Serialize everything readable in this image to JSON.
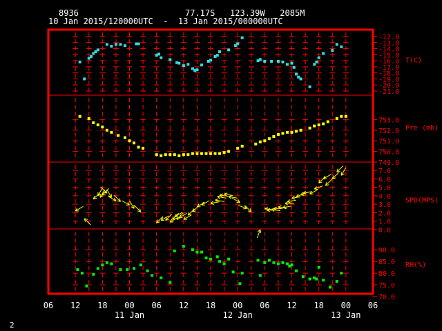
{
  "header": {
    "station_id": "8936",
    "location": "77.17S   123.39W   2085M",
    "time_range": "10 Jan 2015/120000UTC  -  13 Jan 2015/000000UTC"
  },
  "footer": {
    "page_number": "2"
  },
  "colors": {
    "background": "#000000",
    "frame": "#ff0000",
    "header_text": "#ffffff",
    "temperature": "#33dddd",
    "pressure": "#ffff00",
    "wind": "#ffff00",
    "humidity": "#00ee00"
  },
  "chart_data": {
    "type": "scatter",
    "x_unit": "hours since 10 Jan 2015 06 UTC",
    "xlim": [
      0,
      72
    ],
    "x_ticks": [
      {
        "x": 0,
        "label": "06"
      },
      {
        "x": 6,
        "label": "12"
      },
      {
        "x": 12,
        "label": "18"
      },
      {
        "x": 18,
        "label": "00"
      },
      {
        "x": 24,
        "label": "06"
      },
      {
        "x": 30,
        "label": "12"
      },
      {
        "x": 36,
        "label": "18"
      },
      {
        "x": 42,
        "label": "00"
      },
      {
        "x": 48,
        "label": "06"
      },
      {
        "x": 54,
        "label": "12"
      },
      {
        "x": 60,
        "label": "18"
      },
      {
        "x": 66,
        "label": "00"
      },
      {
        "x": 72,
        "label": "06"
      }
    ],
    "day_labels": [
      {
        "x": 18,
        "label": "11 Jan"
      },
      {
        "x": 42,
        "label": "12 Jan"
      },
      {
        "x": 66,
        "label": "13 Jan"
      }
    ],
    "grid_hours": [
      6,
      9,
      12,
      15,
      18,
      21,
      24,
      27,
      30,
      33,
      36,
      39,
      42,
      45,
      48,
      51,
      54,
      57,
      60,
      63,
      66
    ],
    "panels": [
      {
        "id": "temperature",
        "label": "T(C)",
        "ylim": [
          -21,
          -12
        ],
        "ticks": [
          -12,
          -13,
          -14,
          -15,
          -16,
          -17,
          -18,
          -19,
          -20,
          -21
        ],
        "tick_labels": [
          "-12.0",
          "-13.0",
          "-14.0",
          "-15.0",
          "-16.0",
          "-17.0",
          "-18.0",
          "-19.0",
          "-20.0",
          "-21.0"
        ],
        "x": [
          7,
          8,
          9,
          9.5,
          10,
          10.5,
          11,
          13,
          14,
          15,
          16,
          17,
          19.5,
          20,
          24,
          24.5,
          25,
          27,
          28.5,
          29,
          30,
          31,
          32,
          32.5,
          33,
          34,
          35.5,
          36,
          37,
          37.5,
          38,
          40,
          41.5,
          42,
          43,
          46.5,
          47,
          48,
          49.5,
          51,
          52,
          53,
          54,
          54.5,
          55,
          55.5,
          56,
          58,
          59,
          59.5,
          60,
          61,
          63,
          64,
          65
        ],
        "y": [
          -16.2,
          -19,
          -15.6,
          -15.3,
          -14.8,
          -14.5,
          -14.2,
          -13.3,
          -13.6,
          -13.3,
          -13.3,
          -13.5,
          -13.2,
          -13.2,
          -15.1,
          -14.9,
          -15.5,
          -15.8,
          -16.3,
          -16.4,
          -16.8,
          -16.6,
          -17.3,
          -17.6,
          -17.5,
          -16.7,
          -16.1,
          -15.9,
          -15.3,
          -15.1,
          -14.5,
          -14.2,
          -13.5,
          -13.2,
          -12.2,
          -16,
          -15.8,
          -16.1,
          -16.1,
          -16.1,
          -16.2,
          -16.6,
          -16.4,
          -17.1,
          -18.2,
          -18.7,
          -19,
          -20.3,
          -16.6,
          -16.2,
          -15.5,
          -14.8,
          -14.3,
          -13.3,
          -13.7
        ]
      },
      {
        "id": "pressure",
        "label": "Pre (mb)",
        "ylim": [
          749,
          754
        ],
        "ticks": [
          749,
          750,
          751,
          752,
          753
        ],
        "tick_labels": [
          "749.0",
          "750.0",
          "751.0",
          "752.0",
          "753.0"
        ],
        "x": [
          7,
          9,
          10,
          11,
          12,
          13,
          14,
          15.5,
          17,
          18,
          19,
          20,
          21,
          24,
          25,
          26,
          27,
          28,
          29,
          30,
          31,
          32,
          33,
          34,
          35,
          36,
          37,
          38,
          39,
          40,
          42,
          43,
          46,
          47,
          48,
          49,
          50,
          51,
          52,
          53,
          54,
          55,
          56,
          58,
          59,
          60,
          61,
          62,
          64,
          65,
          66
        ],
        "y": [
          753.3,
          753.1,
          752.7,
          752.5,
          752.3,
          752,
          751.8,
          751.5,
          751.3,
          751,
          750.8,
          750.4,
          750.3,
          749.7,
          749.6,
          749.7,
          749.7,
          749.7,
          749.6,
          749.7,
          749.7,
          749.8,
          749.8,
          749.8,
          749.8,
          749.8,
          749.8,
          749.8,
          749.9,
          750,
          750.3,
          750.5,
          750.7,
          750.9,
          751,
          751.2,
          751.4,
          751.6,
          751.7,
          751.8,
          751.8,
          751.9,
          752,
          752.2,
          752.4,
          752.5,
          752.6,
          752.8,
          753.1,
          753.3,
          753.3
        ]
      },
      {
        "id": "wind",
        "label": "SPD(MPS)",
        "ylim": [
          0,
          7
        ],
        "ticks": [
          7,
          6,
          5,
          4,
          3,
          2,
          1,
          0
        ],
        "tick_labels": [
          "7.0",
          "6.0",
          "5.0",
          "4.0",
          "3.0",
          "2.0",
          "1.0",
          "0.0"
        ],
        "x": [
          6,
          8,
          10,
          11,
          11.5,
          12,
          13,
          14,
          15,
          16,
          18,
          19,
          20.5,
          24,
          25,
          26,
          27,
          27.5,
          28,
          28.5,
          29,
          30,
          31,
          32,
          33,
          34,
          36,
          37,
          37.5,
          38,
          39,
          40,
          42.5,
          44,
          45,
          47,
          48,
          48.5,
          49.5,
          50,
          51,
          52,
          52.5,
          53,
          54,
          55,
          56,
          56.5,
          58,
          59,
          60,
          61,
          61.5,
          63,
          64,
          65
        ],
        "y": [
          2.2,
          1.3,
          3.6,
          4,
          3.8,
          4.1,
          4.3,
          3.8,
          3.4,
          3.3,
          2.9,
          2.5,
          2.1,
          0.8,
          1.1,
          1.1,
          0.9,
          1.2,
          1.5,
          1.2,
          1.4,
          1.2,
          1.7,
          2.1,
          2.7,
          2.9,
          3.1,
          3.5,
          3.9,
          4.1,
          4.2,
          3.9,
          3.2,
          2.5,
          2.1,
          0,
          2.5,
          2.3,
          2.4,
          2.5,
          2.7,
          2.6,
          3.1,
          3.3,
          3.7,
          3.9,
          4.1,
          4.3,
          4.2,
          4.8,
          5.5,
          6,
          5.2,
          6,
          6.8,
          6.4
        ],
        "dir_deg": [
          60,
          135,
          45,
          30,
          30,
          45,
          315,
          330,
          300,
          315,
          300,
          330,
          315,
          45,
          60,
          45,
          60,
          45,
          60,
          45,
          60,
          60,
          45,
          45,
          60,
          60,
          80,
          100,
          100,
          100,
          100,
          100,
          300,
          290,
          315,
          200,
          100,
          90,
          100,
          90,
          100,
          80,
          90,
          80,
          80,
          70,
          70,
          80,
          60,
          70,
          45,
          60,
          45,
          45,
          45,
          30
        ]
      },
      {
        "id": "humidity",
        "label": "RH(%)",
        "ylim": [
          70,
          93
        ],
        "ticks": [
          90,
          85,
          80,
          75,
          70
        ],
        "tick_labels": [
          "90.0",
          "85.0",
          "80.0",
          "75.0",
          "70.0"
        ],
        "x": [
          6.5,
          7.5,
          8.5,
          10,
          11,
          12,
          13,
          14,
          16,
          17.5,
          19,
          20.5,
          22,
          23,
          25,
          27,
          28,
          30,
          32,
          33,
          34,
          35,
          36,
          37.5,
          38,
          39,
          40,
          41,
          42.5,
          43,
          46.5,
          47,
          48,
          49,
          50,
          51,
          52,
          53,
          53.5,
          54,
          55,
          56.5,
          58,
          59,
          59.5,
          60,
          61,
          62.5,
          64,
          65
        ],
        "y": [
          81.5,
          80,
          74.5,
          79.5,
          82,
          83.5,
          84.5,
          84,
          81.5,
          81.5,
          82,
          83.5,
          81,
          79,
          78,
          76,
          89.5,
          91.5,
          90,
          89,
          89,
          86.5,
          86,
          87,
          85,
          84,
          86,
          80.5,
          75.5,
          80,
          85.5,
          79,
          84.5,
          85.5,
          84.5,
          84,
          84.5,
          84,
          83,
          83.5,
          81,
          78.5,
          77.5,
          78,
          77.5,
          82.5,
          77,
          74,
          76.5,
          80
        ]
      }
    ]
  }
}
